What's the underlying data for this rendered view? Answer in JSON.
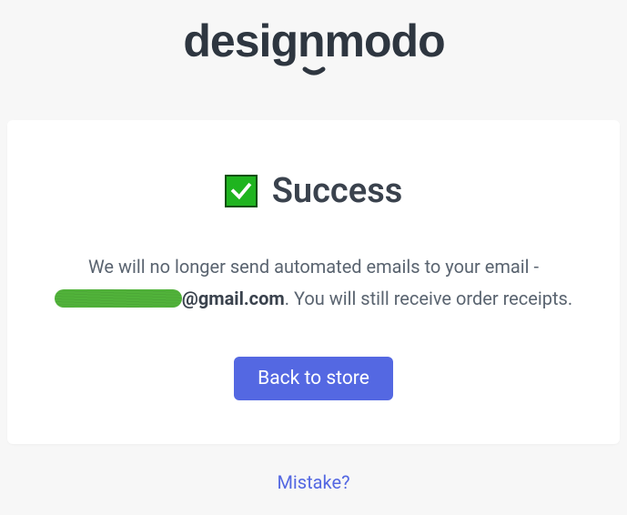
{
  "logo": {
    "alt": "designmodo"
  },
  "success": {
    "title": "Success",
    "message_prefix": "We will no longer send automated emails to your email - ",
    "email_domain": "@gmail.com",
    "message_suffix": ". You will still receive order receipts.",
    "button_label": "Back to store"
  },
  "mistake": {
    "label": "Mistake?"
  },
  "colors": {
    "accent": "#5468e2",
    "success_icon": "#1fb41f"
  }
}
